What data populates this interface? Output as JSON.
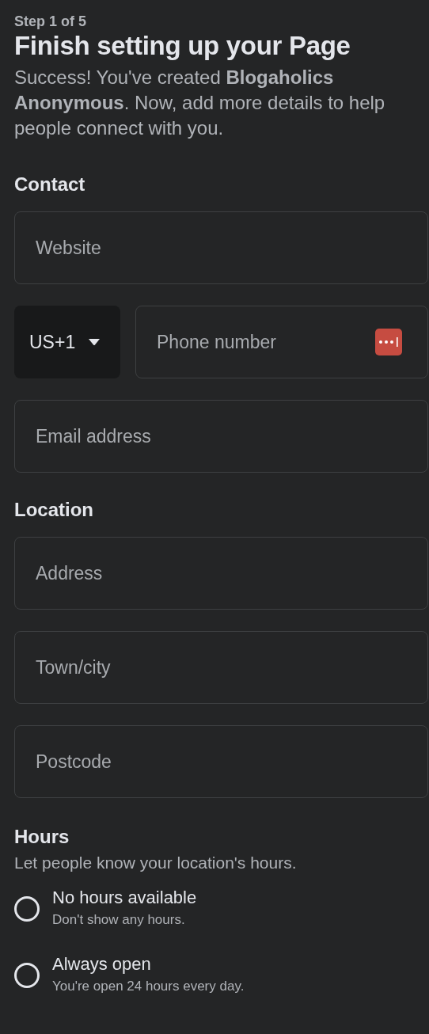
{
  "step": "Step 1 of 5",
  "title": "Finish setting up your Page",
  "description": "Success! You've created **Blogaholics Anonymous**. Now, add more details to help people connect with you.",
  "sections": [
    {
      "heading": "Contact",
      "fields": [
        {
          "kind": "text",
          "placeholder": "Website"
        },
        {
          "kind": "phone",
          "country": "US+1",
          "placeholder": "Phone number"
        },
        {
          "kind": "text",
          "placeholder": "Email address"
        }
      ]
    },
    {
      "heading": "Location",
      "fields": [
        {
          "kind": "text",
          "placeholder": "Address"
        },
        {
          "kind": "text",
          "placeholder": "Town/city"
        },
        {
          "kind": "text",
          "placeholder": "Postcode"
        }
      ]
    }
  ],
  "hours": {
    "heading": "Hours",
    "subtitle": "Let people know your location's hours.",
    "options": [
      {
        "label": "No hours available",
        "hint": "Don't show any hours.",
        "selected": false
      },
      {
        "label": "Always open",
        "hint": "You're open 24 hours every day.",
        "selected": false
      }
    ]
  }
}
